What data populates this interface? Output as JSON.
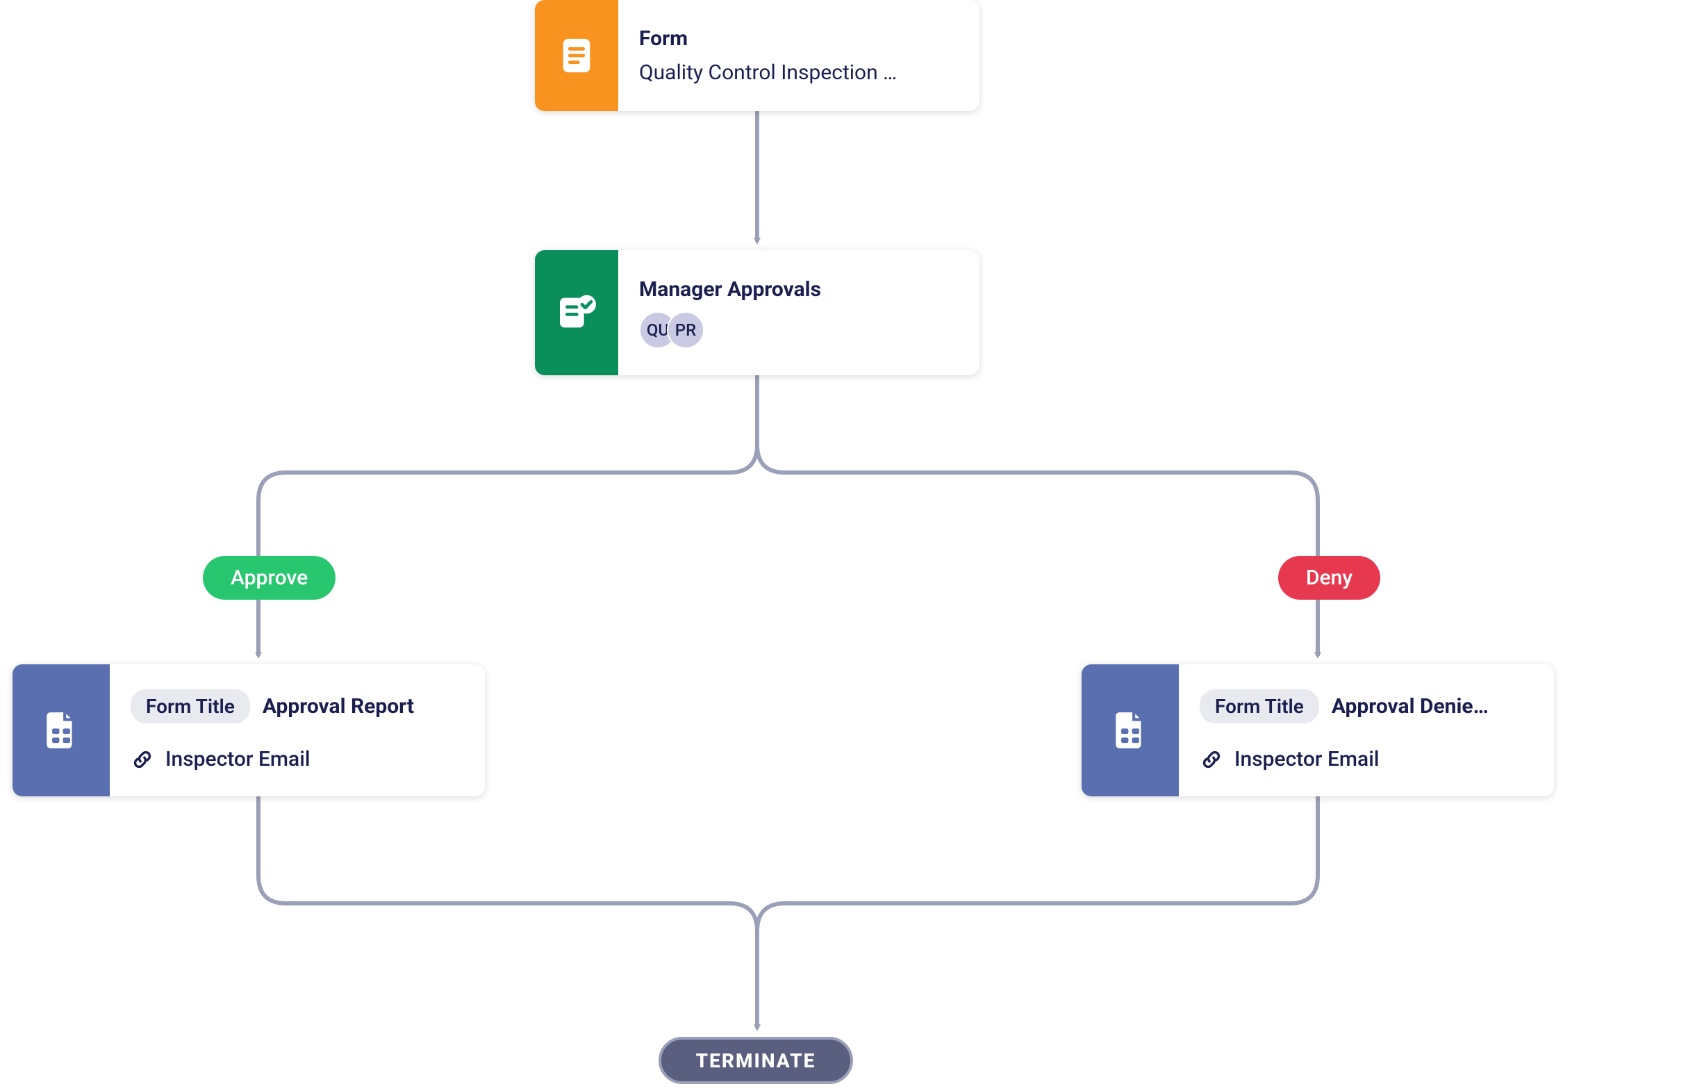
{
  "form_node": {
    "label": "Form",
    "name": "Quality Control Inspection …",
    "stripe_color": "#f7931e",
    "icon": "form-icon"
  },
  "approval_node": {
    "title": "Manager Approvals",
    "stripe_color": "#0a8f5b",
    "avatars": [
      "QU",
      "PR"
    ],
    "icon": "approval-icon"
  },
  "branches": {
    "approve": {
      "label": "Approve",
      "color": "#28c76f"
    },
    "deny": {
      "label": "Deny",
      "color": "#e63950"
    }
  },
  "doc_left": {
    "form_title_label": "Form Title",
    "form_title_value": "Approval Report",
    "link_text": "Inspector Email",
    "stripe_color": "#5a6fb0",
    "icon": "document-icon"
  },
  "doc_right": {
    "form_title_label": "Form Title",
    "form_title_value": "Approval Denie…",
    "link_text": "Inspector Email",
    "stripe_color": "#5a6fb0",
    "icon": "document-icon"
  },
  "terminate": {
    "label": "TERMINATE"
  },
  "connector_color": "#9aa0b8"
}
